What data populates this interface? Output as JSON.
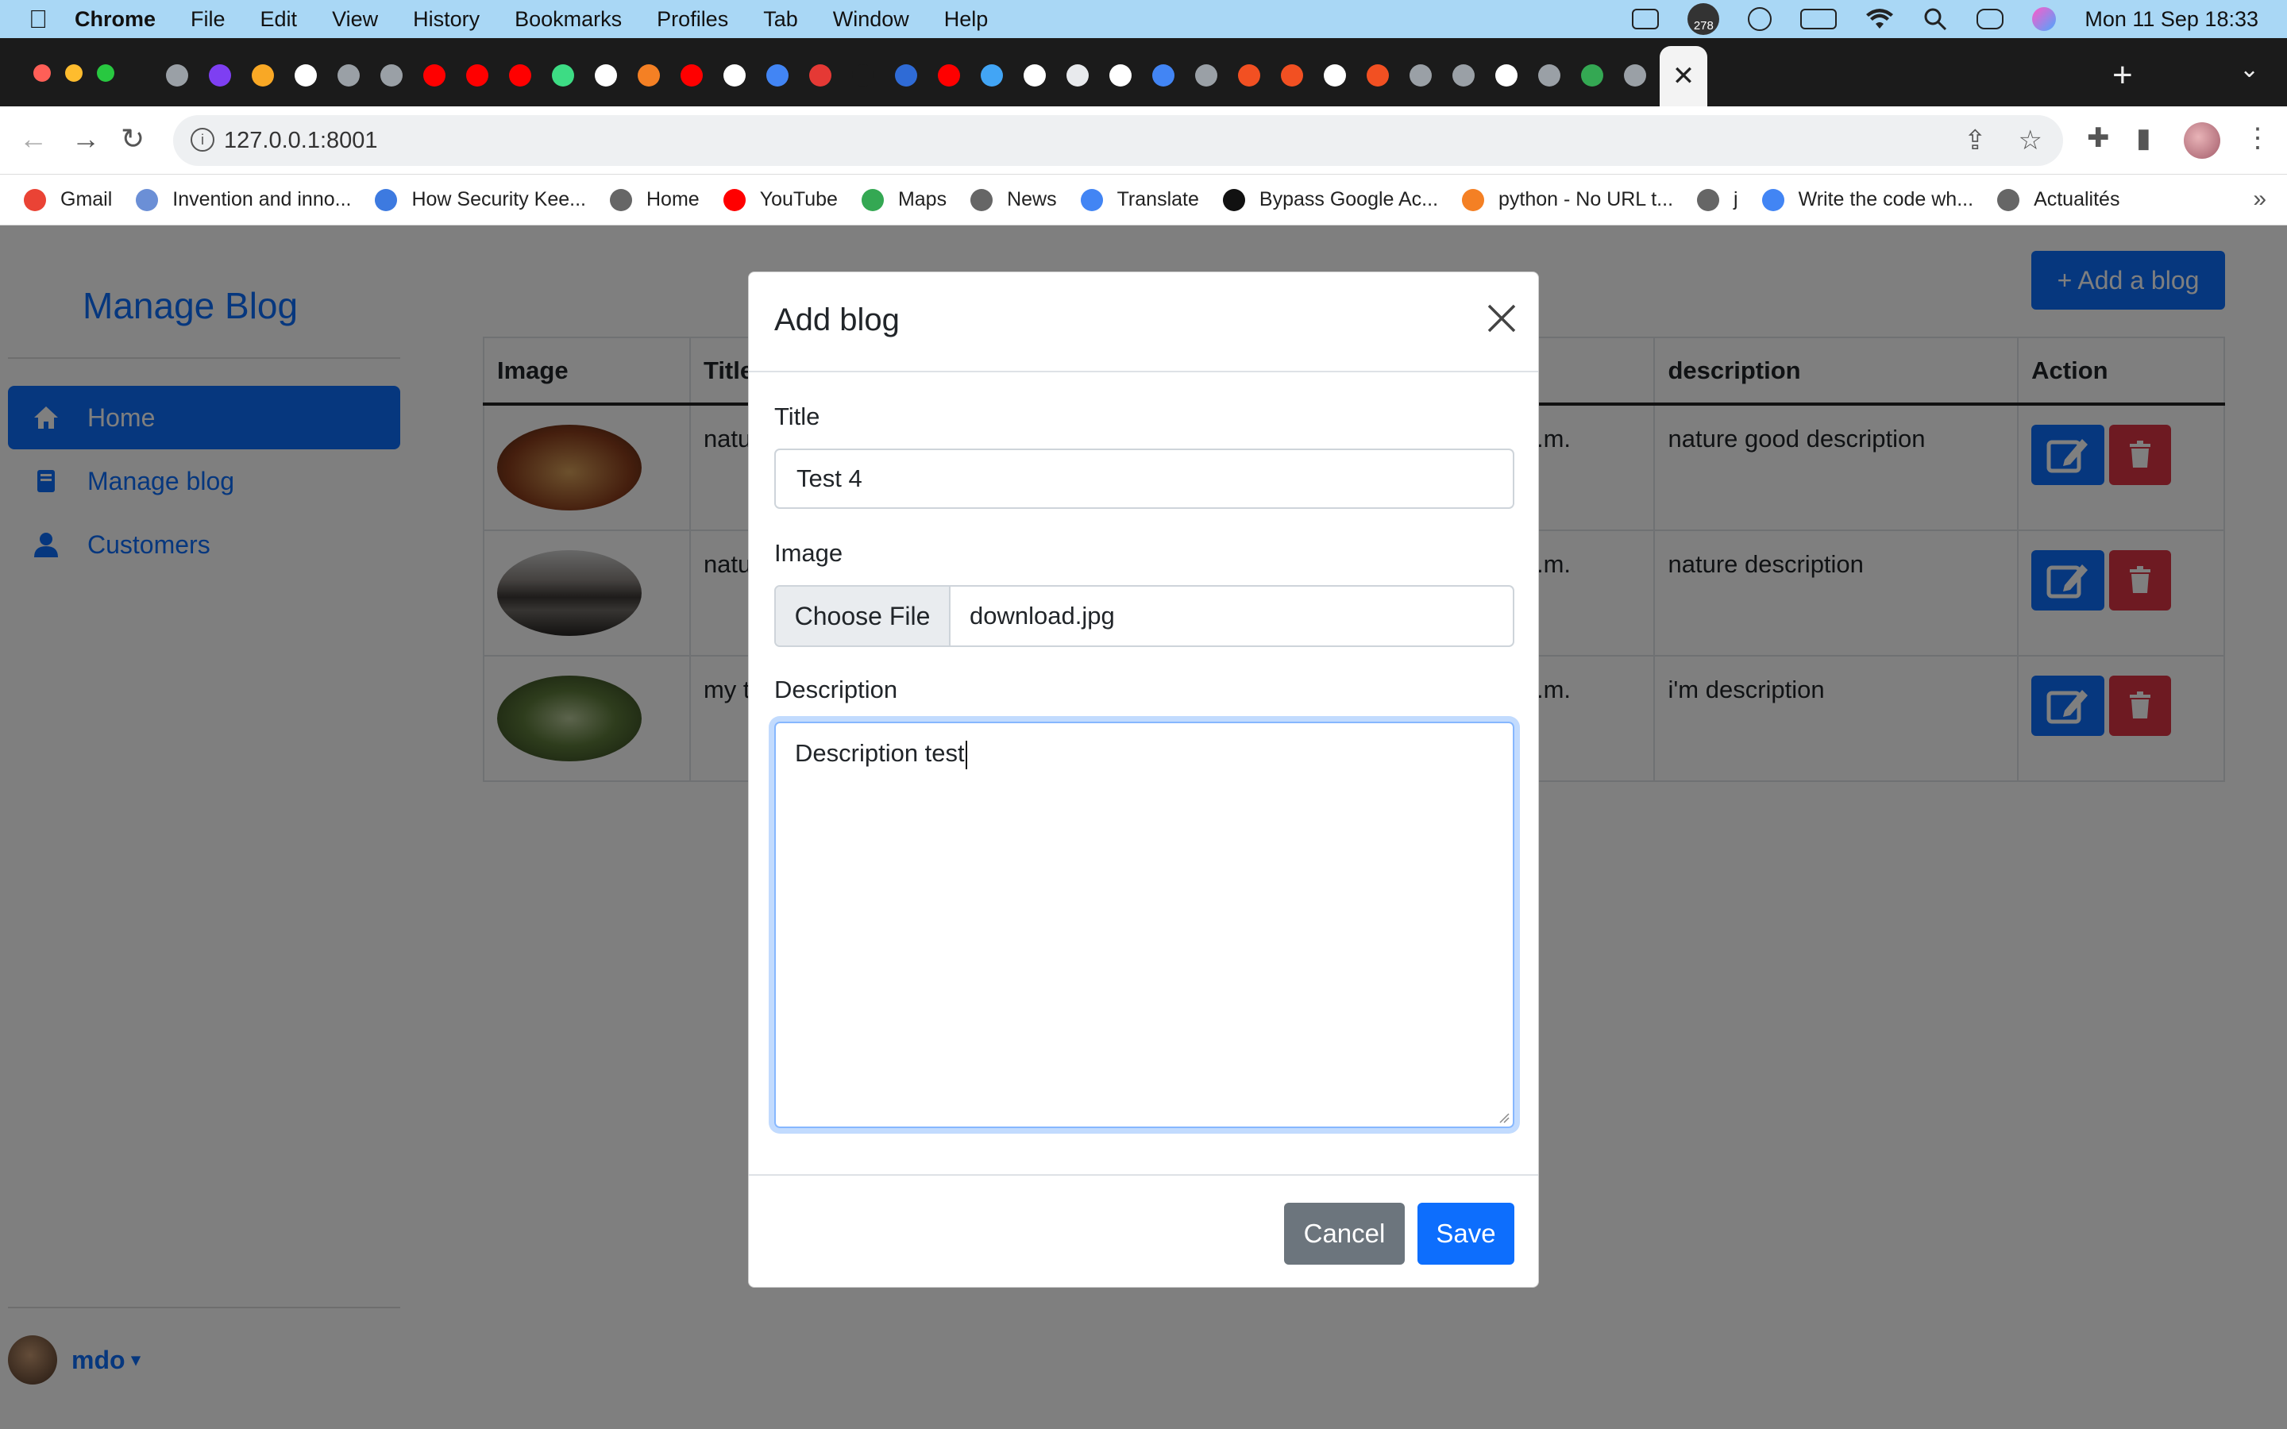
{
  "menubar": {
    "app": "Chrome",
    "items": [
      "File",
      "Edit",
      "View",
      "History",
      "Bookmarks",
      "Profiles",
      "Tab",
      "Window",
      "Help"
    ],
    "badge": "278",
    "clock": "Mon 11 Sep  18:33"
  },
  "toolbar": {
    "url": "127.0.0.1:8001"
  },
  "bookmarks": [
    {
      "label": "Gmail",
      "color": "#ea4335"
    },
    {
      "label": "Invention and inno...",
      "color": "#6b8fd6"
    },
    {
      "label": "How Security Kee...",
      "color": "#3d7ae0"
    },
    {
      "label": "Home",
      "color": "#666666"
    },
    {
      "label": "YouTube",
      "color": "#ff0000"
    },
    {
      "label": "Maps",
      "color": "#34a853"
    },
    {
      "label": "News",
      "color": "#666666"
    },
    {
      "label": "Translate",
      "color": "#4285f4"
    },
    {
      "label": "Bypass Google Ac...",
      "color": "#111111"
    },
    {
      "label": "python - No URL t...",
      "color": "#f48024"
    },
    {
      "label": "j",
      "color": "#666666"
    },
    {
      "label": "Write the code wh...",
      "color": "#4285f4"
    },
    {
      "label": "Actualités",
      "color": "#666666"
    }
  ],
  "sidebar": {
    "brand": "Manage Blog",
    "items": [
      {
        "label": "Home"
      },
      {
        "label": "Manage blog"
      },
      {
        "label": "Customers"
      }
    ],
    "user": "mdo"
  },
  "main": {
    "add_button": "+ Add a blog",
    "columns": [
      "Image",
      "Title",
      "",
      "description",
      "Action"
    ],
    "rows": [
      {
        "title": "natu",
        "created": ".m.",
        "description": "nature good description"
      },
      {
        "title": "natu",
        "created": ".m.",
        "description": "nature description"
      },
      {
        "title": "my t",
        "created": ".m.",
        "description": "i'm description"
      }
    ]
  },
  "modal": {
    "title": "Add blog",
    "title_label": "Title",
    "title_value": "Test 4",
    "image_label": "Image",
    "file_button": "Choose File",
    "file_name": "download.jpg",
    "description_label": "Description",
    "description_value": "Description test",
    "cancel": "Cancel",
    "save": "Save"
  }
}
